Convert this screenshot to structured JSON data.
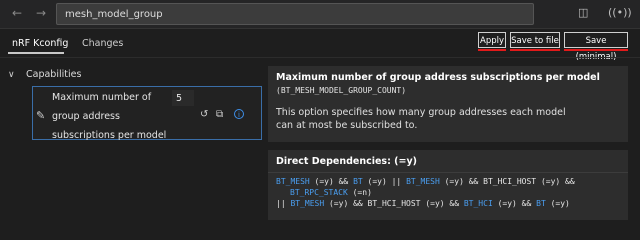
{
  "search": {
    "value": "mesh_model_group"
  },
  "tabs": [
    {
      "label": "nRF Kconfig"
    },
    {
      "label": "Changes"
    }
  ],
  "actions": {
    "apply": "Apply",
    "save_to_file": "Save to file",
    "save_minimal": "Save (minimal)"
  },
  "tree": {
    "category": "Capabilities",
    "item": {
      "label_lines": [
        "Maximum number of",
        "group address",
        "subscriptions per model"
      ],
      "value": "5"
    }
  },
  "help": {
    "title": "Maximum number of group address subscriptions per model",
    "symbol": "(BT_MESH_MODEL_GROUP_COUNT)",
    "description": "This option specifies how many group addresses each model can at most be subscribed to."
  },
  "dependencies": {
    "title": "Direct Dependencies: (=y)",
    "line1": {
      "a": "BT_MESH",
      "a_v": " (=y) && ",
      "b": "BT",
      "b_v": " (=y) || ",
      "c": "BT_MESH",
      "c_v": " (=y) && BT_HCI_HOST (=y) &&"
    },
    "line2": {
      "a": "BT_RPC_STACK",
      "a_v": " (=n)"
    },
    "line3": {
      "pre": "|| ",
      "a": "BT_MESH",
      "a_v": " (=y) && BT_HCI_HOST (=y) && ",
      "b": "BT_HCI",
      "b_v": " (=y) && ",
      "c": "BT",
      "c_v": " (=y)"
    }
  },
  "colors": {
    "accent": "#3d8ee8",
    "highlight": "#e21a1a",
    "symbol_link": "#4a9ef0"
  }
}
